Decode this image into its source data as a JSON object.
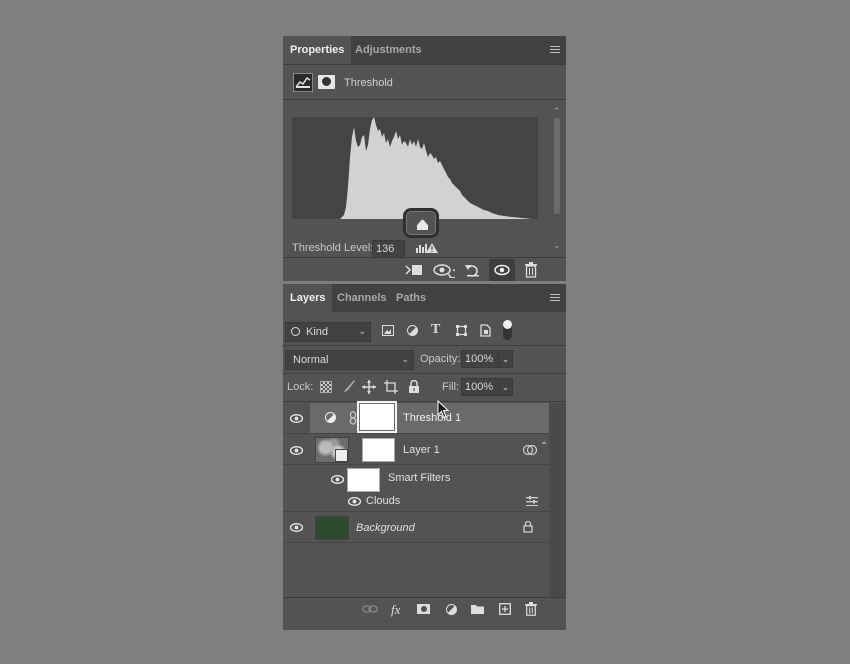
{
  "properties_panel": {
    "tabs": [
      "Properties",
      "Adjustments"
    ],
    "adjustment_name": "Threshold",
    "threshold_label": "Threshold Level:",
    "threshold_value": "136",
    "threshold_fraction": 0.533,
    "footer_icons": [
      "clip-to-layer-icon",
      "view-previous-state-icon",
      "reset-icon",
      "visibility-icon",
      "delete-icon"
    ]
  },
  "layers_panel": {
    "tabs": [
      "Layers",
      "Channels",
      "Paths"
    ],
    "filter_kind": "Kind",
    "blend_mode": "Normal",
    "opacity_label": "Opacity:",
    "opacity_value": "100%",
    "lock_label": "Lock:",
    "fill_label": "Fill:",
    "fill_value": "100%",
    "layers": [
      {
        "name": "Threshold 1",
        "type": "adjustment"
      },
      {
        "name": "Layer 1",
        "type": "smart-object"
      },
      {
        "name": "Smart Filters",
        "type": "smart-filters"
      },
      {
        "name": "Clouds",
        "type": "filter"
      },
      {
        "name": "Background",
        "type": "background"
      }
    ],
    "background_color": "#2e4a2e"
  }
}
